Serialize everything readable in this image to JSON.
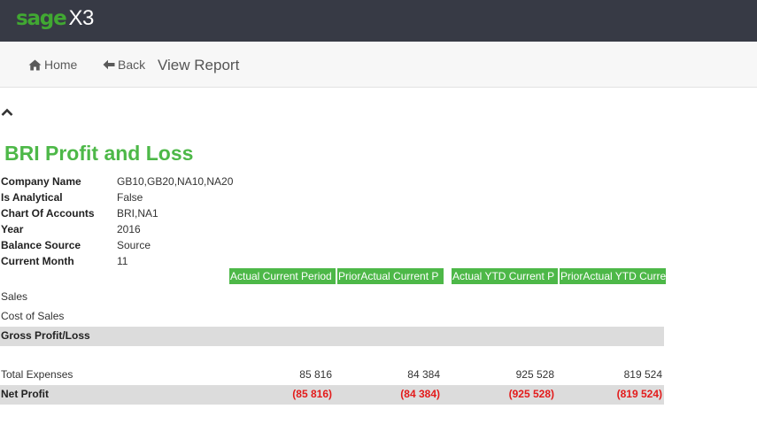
{
  "app": {
    "logo_brand": "sage",
    "logo_product": "X3",
    "brand_color": "#41a832"
  },
  "nav": {
    "home_label": "Home",
    "home_icon": "home-icon",
    "back_label": "Back",
    "back_icon": "arrow-left-icon",
    "page_title": "View Report"
  },
  "report": {
    "collapse_icon": "chevron-up-icon",
    "title": "BRI Profit and Loss",
    "params": [
      {
        "label": "Company Name",
        "value": "GB10,GB20,NA10,NA20"
      },
      {
        "label": "Is Analytical",
        "value": "False"
      },
      {
        "label": "Chart Of Accounts",
        "value": "BRI,NA1"
      },
      {
        "label": "Year",
        "value": "2016"
      },
      {
        "label": "Balance Source",
        "value": "Source"
      },
      {
        "label": "Current Month",
        "value": "11"
      }
    ],
    "columns": [
      "Actual Current Period",
      "PriorActual Current P",
      "Actual YTD Current P",
      "PriorActual YTD Curre"
    ],
    "rows": [
      {
        "label": "Sales",
        "values": [
          "",
          "",
          "",
          ""
        ]
      },
      {
        "label": "Cost of Sales",
        "values": [
          "",
          "",
          "",
          ""
        ]
      },
      {
        "label": "Gross Profit/Loss",
        "values": [
          "",
          "",
          "",
          ""
        ]
      },
      {
        "label": "",
        "values": [
          "",
          "",
          "",
          ""
        ]
      },
      {
        "label": "Total Expenses",
        "values": [
          "85 816",
          "84 384",
          "925 528",
          "819 524"
        ]
      },
      {
        "label": "Net Profit",
        "values": [
          "(85 816)",
          "(84 384)",
          "(925 528)",
          "(819 524)"
        ]
      }
    ],
    "header_color": "#4db848",
    "negative_color": "#e31b1b"
  }
}
